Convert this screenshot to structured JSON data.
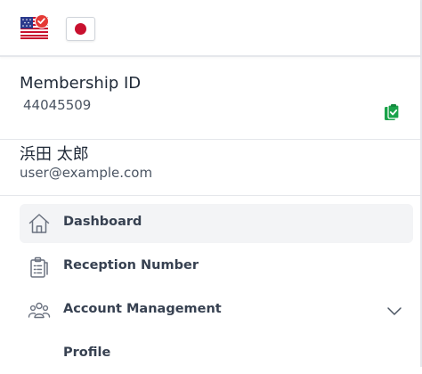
{
  "languages": {
    "selected_icon": "us-flag-icon",
    "options": [
      "us-flag-icon",
      "japan-flag-icon"
    ]
  },
  "membership": {
    "label": "Membership ID",
    "id": "44045509",
    "copy_icon": "clipboard-check-icon"
  },
  "user": {
    "name": "浜田 太郎",
    "email": "user@example.com"
  },
  "nav": {
    "items": [
      {
        "label": "Dashboard",
        "icon": "home-icon",
        "active": true
      },
      {
        "label": "Reception Number",
        "icon": "clipboard-list-icon",
        "active": false
      },
      {
        "label": "Account Management",
        "icon": "users-icon",
        "active": false,
        "expandable": true
      },
      {
        "label": "Profile",
        "icon": "",
        "active": false
      }
    ]
  },
  "colors": {
    "accent_green": "#1aa34a",
    "badge_red": "#e53935",
    "active_bg": "#f3f4f6"
  }
}
